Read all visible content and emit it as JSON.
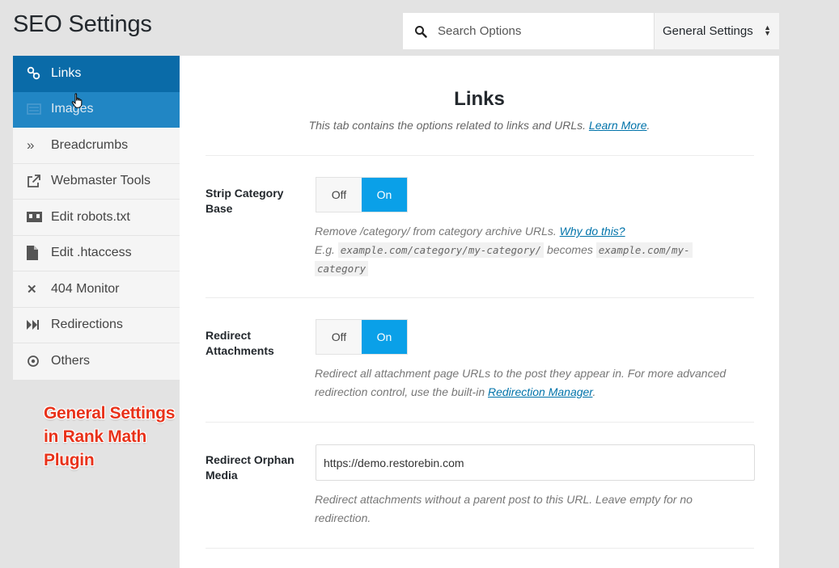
{
  "header": {
    "title": "SEO Settings"
  },
  "search": {
    "placeholder": "Search Options",
    "icon": "search-icon"
  },
  "settings_select": {
    "value": "General Settings"
  },
  "sidebar": {
    "items": [
      {
        "label": "Links",
        "icon": "link-icon",
        "state": "active"
      },
      {
        "label": "Images",
        "icon": "image-icon",
        "state": "hover"
      },
      {
        "label": "Breadcrumbs",
        "icon": "chevrons-right-icon"
      },
      {
        "label": "Webmaster Tools",
        "icon": "external-link-icon"
      },
      {
        "label": "Edit robots.txt",
        "icon": "robot-icon"
      },
      {
        "label": "Edit .htaccess",
        "icon": "file-icon"
      },
      {
        "label": "404 Monitor",
        "icon": "close-icon"
      },
      {
        "label": "Redirections",
        "icon": "fast-forward-icon"
      },
      {
        "label": "Others",
        "icon": "circle-dot-icon"
      }
    ]
  },
  "annotation": {
    "line1": "General Settings",
    "line2": "in Rank Math",
    "line3": "Plugin",
    "color": "#e8321a"
  },
  "main": {
    "title": "Links",
    "description": "This tab contains the options related to links and URLs. ",
    "learn_more": "Learn More",
    "period": ".",
    "fields": {
      "strip_category": {
        "label": "Strip Category Base",
        "off": "Off",
        "on": "On",
        "desc": "Remove /category/ from category archive URLs. ",
        "why_link": "Why do this?",
        "eg": "E.g.",
        "code1": "example.com/category/my-category/",
        "becomes": "becomes",
        "code2a": "example.com/my-",
        "code2b": "category"
      },
      "redirect_attachments": {
        "label": "Redirect Attachments",
        "off": "Off",
        "on": "On",
        "desc": "Redirect all attachment page URLs to the post they appear in. For more advanced redirection control, use the built-in ",
        "link": "Redirection Manager",
        "period": "."
      },
      "redirect_orphan": {
        "label": "Redirect Orphan Media",
        "value": "https://demo.restorebin.com",
        "desc": "Redirect attachments without a parent post to this URL. Leave empty for no redirection."
      }
    }
  },
  "colors": {
    "active": "#0a6ba8",
    "toggle_on": "#0aa0e8",
    "link": "#0073aa"
  }
}
